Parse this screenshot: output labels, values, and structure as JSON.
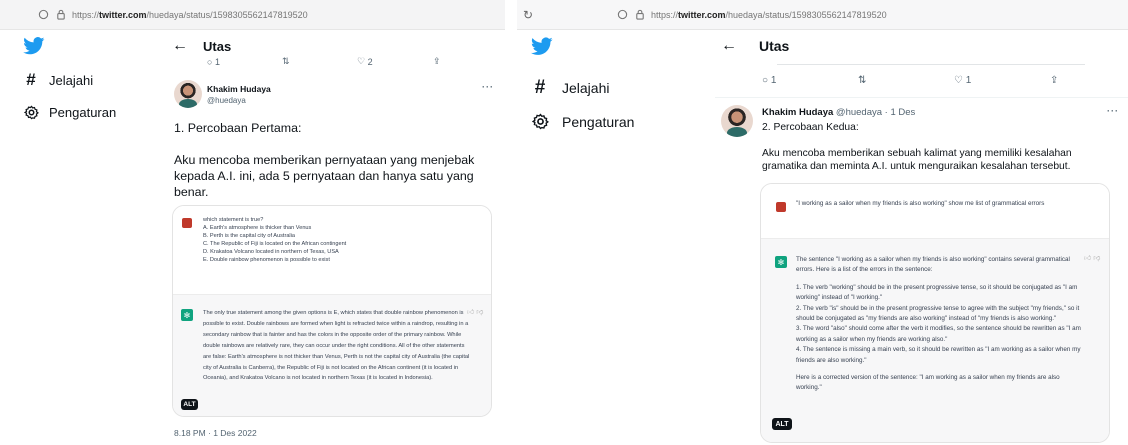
{
  "left": {
    "url": {
      "scheme": "https://",
      "host": "twitter.com",
      "path": "/huedaya/status/1598305562147819520"
    },
    "nav": [
      {
        "icon": "home-bird-icon"
      },
      {
        "icon": "hash-icon",
        "label": "Jelajahi"
      },
      {
        "icon": "gear-icon",
        "label": "Pengaturan"
      }
    ],
    "header": {
      "back": "←",
      "title": "Utas"
    },
    "prev_actions": [
      {
        "icon": "reply-icon",
        "count": "1"
      },
      {
        "icon": "retweet-icon",
        "count": ""
      },
      {
        "icon": "like-icon",
        "count": "2"
      },
      {
        "icon": "share-icon",
        "count": ""
      }
    ],
    "tweet": {
      "name": "Khakim Hudaya",
      "handle": "@huedaya",
      "more": "···",
      "text": [
        "1. Percobaan Pertama:",
        "",
        "Aku mencoba memberikan pernyataan yang menjebak kepada A.I. ini, ada 5 pernyataan dan hanya satu yang benar."
      ],
      "user_prompt": [
        "which statement is true?",
        "A. Earth's atmosphere is thicker than Venus",
        "B. Perth is the capital city of Australia",
        "C. The Republic of Fiji is located on the African contingent",
        "D. Krakatoa Volcano located in northern of Texas, USA",
        "E.  Double rainbow phenomenon is possible to exist"
      ],
      "bot_reply": "The only true statement among the given options is E, which states that double rainbow phenomenon is possible to exist. Double rainbows are formed when light is refracted twice within a raindrop, resulting in a secondary rainbow that is fainter and has the colors in the opposite order of the primary rainbow. While double rainbows are relatively rare, they can occur under the right conditions. All of the other statements are false: Earth's atmosphere is not thicker than Venus, Perth is not the capital city of Australia (the capital city of Australia is Canberra), the Republic of Fiji is not located on the African continent (it is located in Oceania), and Krakatoa Volcano is not located in northern Texas (it is located in Indonesia).",
      "alt": "ALT",
      "timestamp": "8.18 PM · 1 Des 2022"
    }
  },
  "right": {
    "url": {
      "scheme": "https://",
      "host": "twitter.com",
      "path": "/huedaya/status/1598305562147819520"
    },
    "nav": [
      {
        "icon": "home-bird-icon"
      },
      {
        "icon": "hash-icon",
        "label": "Jelajahi"
      },
      {
        "icon": "gear-icon",
        "label": "Pengaturan"
      }
    ],
    "header": {
      "back": "←",
      "title": "Utas"
    },
    "prev_actions": [
      {
        "icon": "reply-icon",
        "count": "1"
      },
      {
        "icon": "retweet-icon",
        "count": ""
      },
      {
        "icon": "like-icon",
        "count": "1"
      },
      {
        "icon": "share-icon",
        "count": ""
      }
    ],
    "tweet": {
      "name": "Khakim Hudaya",
      "handle": "@huedaya · 1 Des",
      "more": "···",
      "text": [
        "2. Percobaan Kedua:",
        "",
        "Aku mencoba memberikan sebuah kalimat yang memiliki kesalahan gramatika dan meminta A.I. untuk menguraikan kesalahan tersebut."
      ],
      "user_prompt": "\"I working as a sailor when my friends is also working\" show me list of grammatical errors",
      "bot_intro": "The sentence \"I working as a sailor when my friends is also working\" contains several grammatical errors. Here is a list of the errors in the sentence:",
      "bot_list": [
        "1. The verb \"working\" should be in the present progressive tense, so it should be conjugated as \"I am working\" instead of \"I working.\"",
        "2. The verb \"is\" should be in the present progressive tense to agree with the subject \"my friends,\" so it should be conjugated as \"my friends are also working\" instead of \"my friends is also working.\"",
        "3. The word \"also\" should come after the verb it modifies, so the sentence should be rewritten as \"I am working as a sailor when my friends are working also.\"",
        "4. The sentence is missing a main verb, so it should be rewritten as \"I am working as a sailor when my friends are also working.\""
      ],
      "bot_outro": "Here is a corrected version of the sentence: \"I am working as a sailor when my friends are also working.\"",
      "alt": "ALT"
    }
  },
  "colors": {
    "twitter_blue": "#1d9bf0",
    "bot_green": "#10a37f",
    "user_red": "#c0392b"
  }
}
